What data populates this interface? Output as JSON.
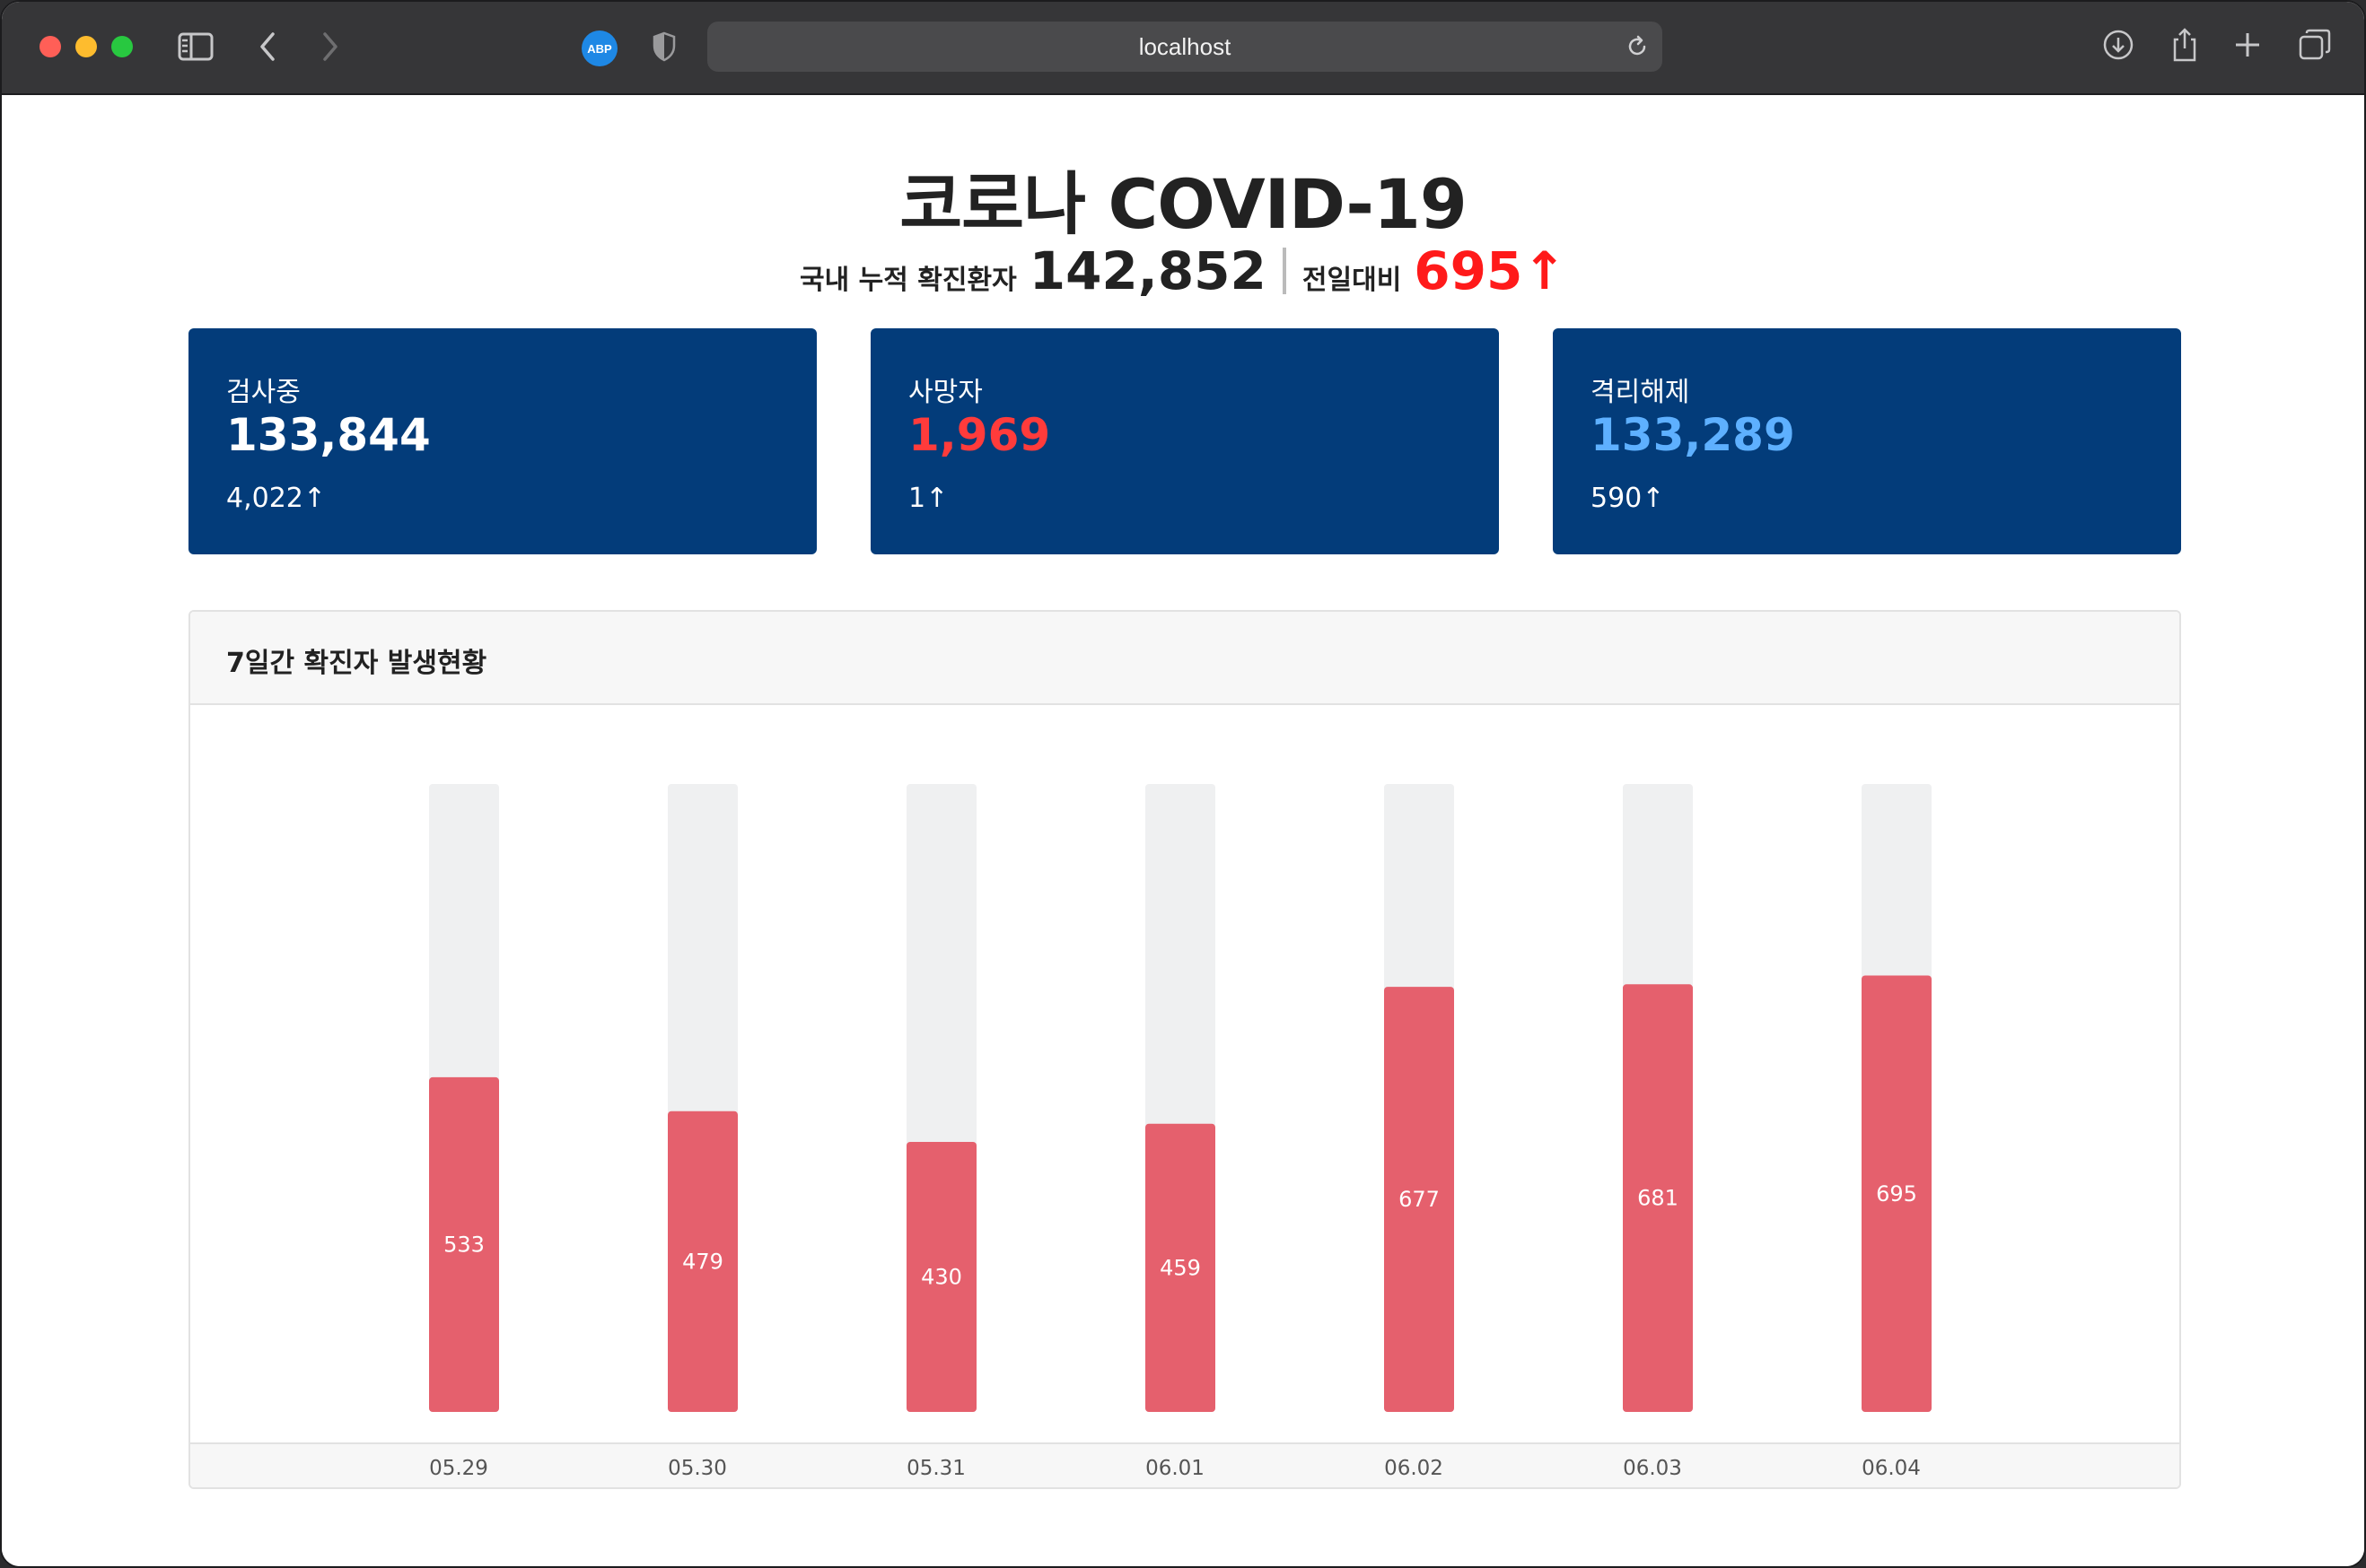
{
  "browser": {
    "address": "localhost",
    "extension_badge": "ABP"
  },
  "header": {
    "title": "코로나 COVID-19",
    "cumulative_label": "국내 누적 확진환자",
    "cumulative_value": "142,852",
    "daily_label": "전일대비",
    "daily_value": "695↑"
  },
  "cards": [
    {
      "label": "검사중",
      "value": "133,844",
      "delta": "4,022↑",
      "value_color": "#ffffff"
    },
    {
      "label": "사망자",
      "value": "1,969",
      "delta": "1↑",
      "value_color": "#ff3b3b"
    },
    {
      "label": "격리해제",
      "value": "133,289",
      "delta": "590↑",
      "value_color": "#5eb0ff"
    }
  ],
  "chart_section": {
    "title": "7일간 확진자 발생현황"
  },
  "chart_data": {
    "type": "bar",
    "categories": [
      "05.29",
      "05.30",
      "05.31",
      "06.01",
      "06.02",
      "06.03",
      "06.04"
    ],
    "values": [
      533,
      479,
      430,
      459,
      677,
      681,
      695
    ],
    "ylim": [
      0,
      1000
    ],
    "bar_color": "#e5606d",
    "track_color": "#eff0f1",
    "grid": false
  }
}
